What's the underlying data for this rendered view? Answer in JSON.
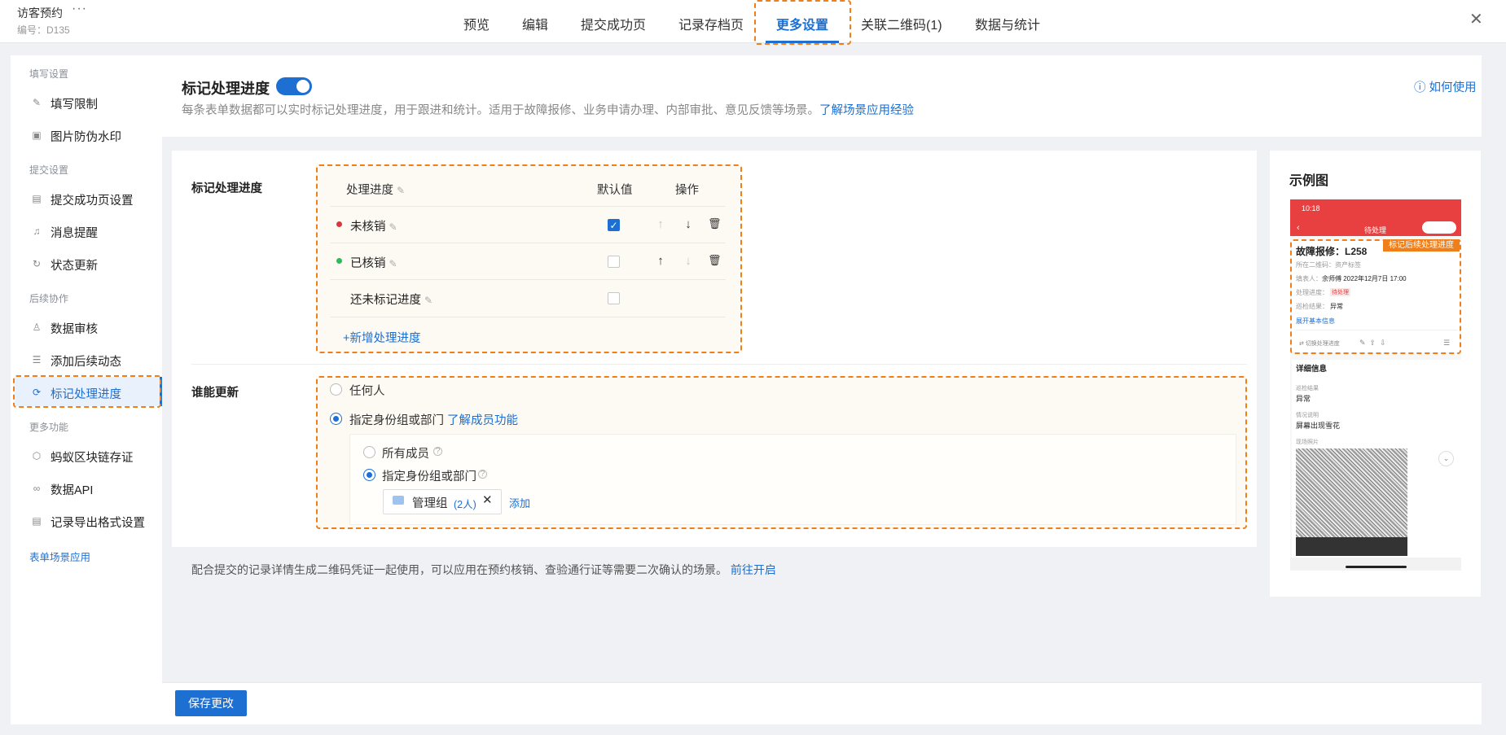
{
  "app": {
    "title": "访客预约",
    "more": "···",
    "code": "编号：D135",
    "close": "✕"
  },
  "nav": [
    "预览",
    "编辑",
    "提交成功页",
    "记录存档页",
    "更多设置",
    "关联二维码(1)",
    "数据与统计"
  ],
  "sidebar": {
    "groups": [
      "填写设置",
      "提交设置",
      "后续协作",
      "更多功能"
    ],
    "items": [
      "填写限制",
      "图片防伪水印",
      "提交成功页设置",
      "消息提醒",
      "状态更新",
      "数据审核",
      "添加后续动态",
      "标记处理进度",
      "蚂蚁区块链存证",
      "数据API",
      "记录导出格式设置"
    ],
    "footer_link": "表单场景应用"
  },
  "header": {
    "title": "标记处理进度",
    "toggle_on": true,
    "desc": "每条表单数据都可以实时标记处理进度，用于跟进和统计。适用于故障报修、业务申请办理、内部审批、意见反馈等场景。",
    "desc_link": "了解场景应用经验",
    "help": "如何使用"
  },
  "progress": {
    "label": "标记处理进度",
    "columns": [
      "处理进度",
      "默认值",
      "操作"
    ],
    "rows": [
      {
        "name": "未核销",
        "color": "#d9363e",
        "default": true
      },
      {
        "name": "已核销",
        "color": "#2dbb55",
        "default": false
      },
      {
        "name": "还未标记进度",
        "color": "",
        "default": false
      }
    ],
    "add_label": "+新增处理进度"
  },
  "who": {
    "label": "谁能更新",
    "option_anyone": "任何人",
    "option_specified": "指定身份组或部门",
    "learn_link": "了解成员功能",
    "sub_all": "所有成员",
    "sub_specified": "指定身份组或部门",
    "tag_name": "管理组",
    "tag_count": "(2人)",
    "add": "添加"
  },
  "note": {
    "text": "配合提交的记录详情生成二维码凭证一起使用，可以应用在预约核销、查验通行证等需要二次确认的场景。",
    "link": "前往开启"
  },
  "preview": {
    "title": "示例图",
    "time": "10:18",
    "header": "待处理",
    "badge": "标记后续处理进度",
    "card_title": "故障报修：L258",
    "qr_line": "所在二维码：资产标签",
    "filler": "填表人：",
    "filler_name": "余师傅",
    "filler_time": "2022年12月7日 17:00",
    "progress_label": "处理进度：",
    "progress_value": "待处理",
    "result_label": "巡检结果：",
    "result_value": "异常",
    "expand": "展开基本信息",
    "switch": "切换处理进度",
    "detail_title": "详细信息",
    "f1_label": "巡检结果",
    "f1_value": "异常",
    "f2_label": "情况说明",
    "f2_value": "屏幕出现雪花",
    "f3_label": "现场照片"
  },
  "save_label": "保存更改"
}
